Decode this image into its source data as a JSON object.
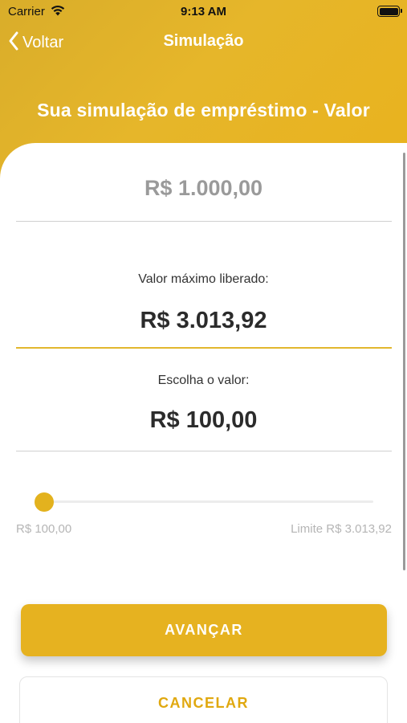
{
  "status_bar": {
    "carrier": "Carrier",
    "time": "9:13 AM"
  },
  "nav": {
    "back_label": "Voltar",
    "title": "Simulação"
  },
  "page_heading": "Sua simulação de empréstimo - Valor",
  "loan": {
    "requested_amount": "R$ 1.000,00",
    "max_label": "Valor máximo liberado:",
    "max_value": "R$ 3.013,92",
    "choose_label": "Escolha o valor:",
    "chosen_value": "R$ 100,00"
  },
  "slider": {
    "min_label": "R$ 100,00",
    "max_label": "Limite R$ 3.013,92",
    "level": 0.0
  },
  "actions": {
    "advance_label": "AVANÇAR",
    "cancel_label": "CANCELAR"
  },
  "colors": {
    "accent": "#e6b220",
    "header": "#e3b22a",
    "muted_text": "#9a9a9a"
  }
}
